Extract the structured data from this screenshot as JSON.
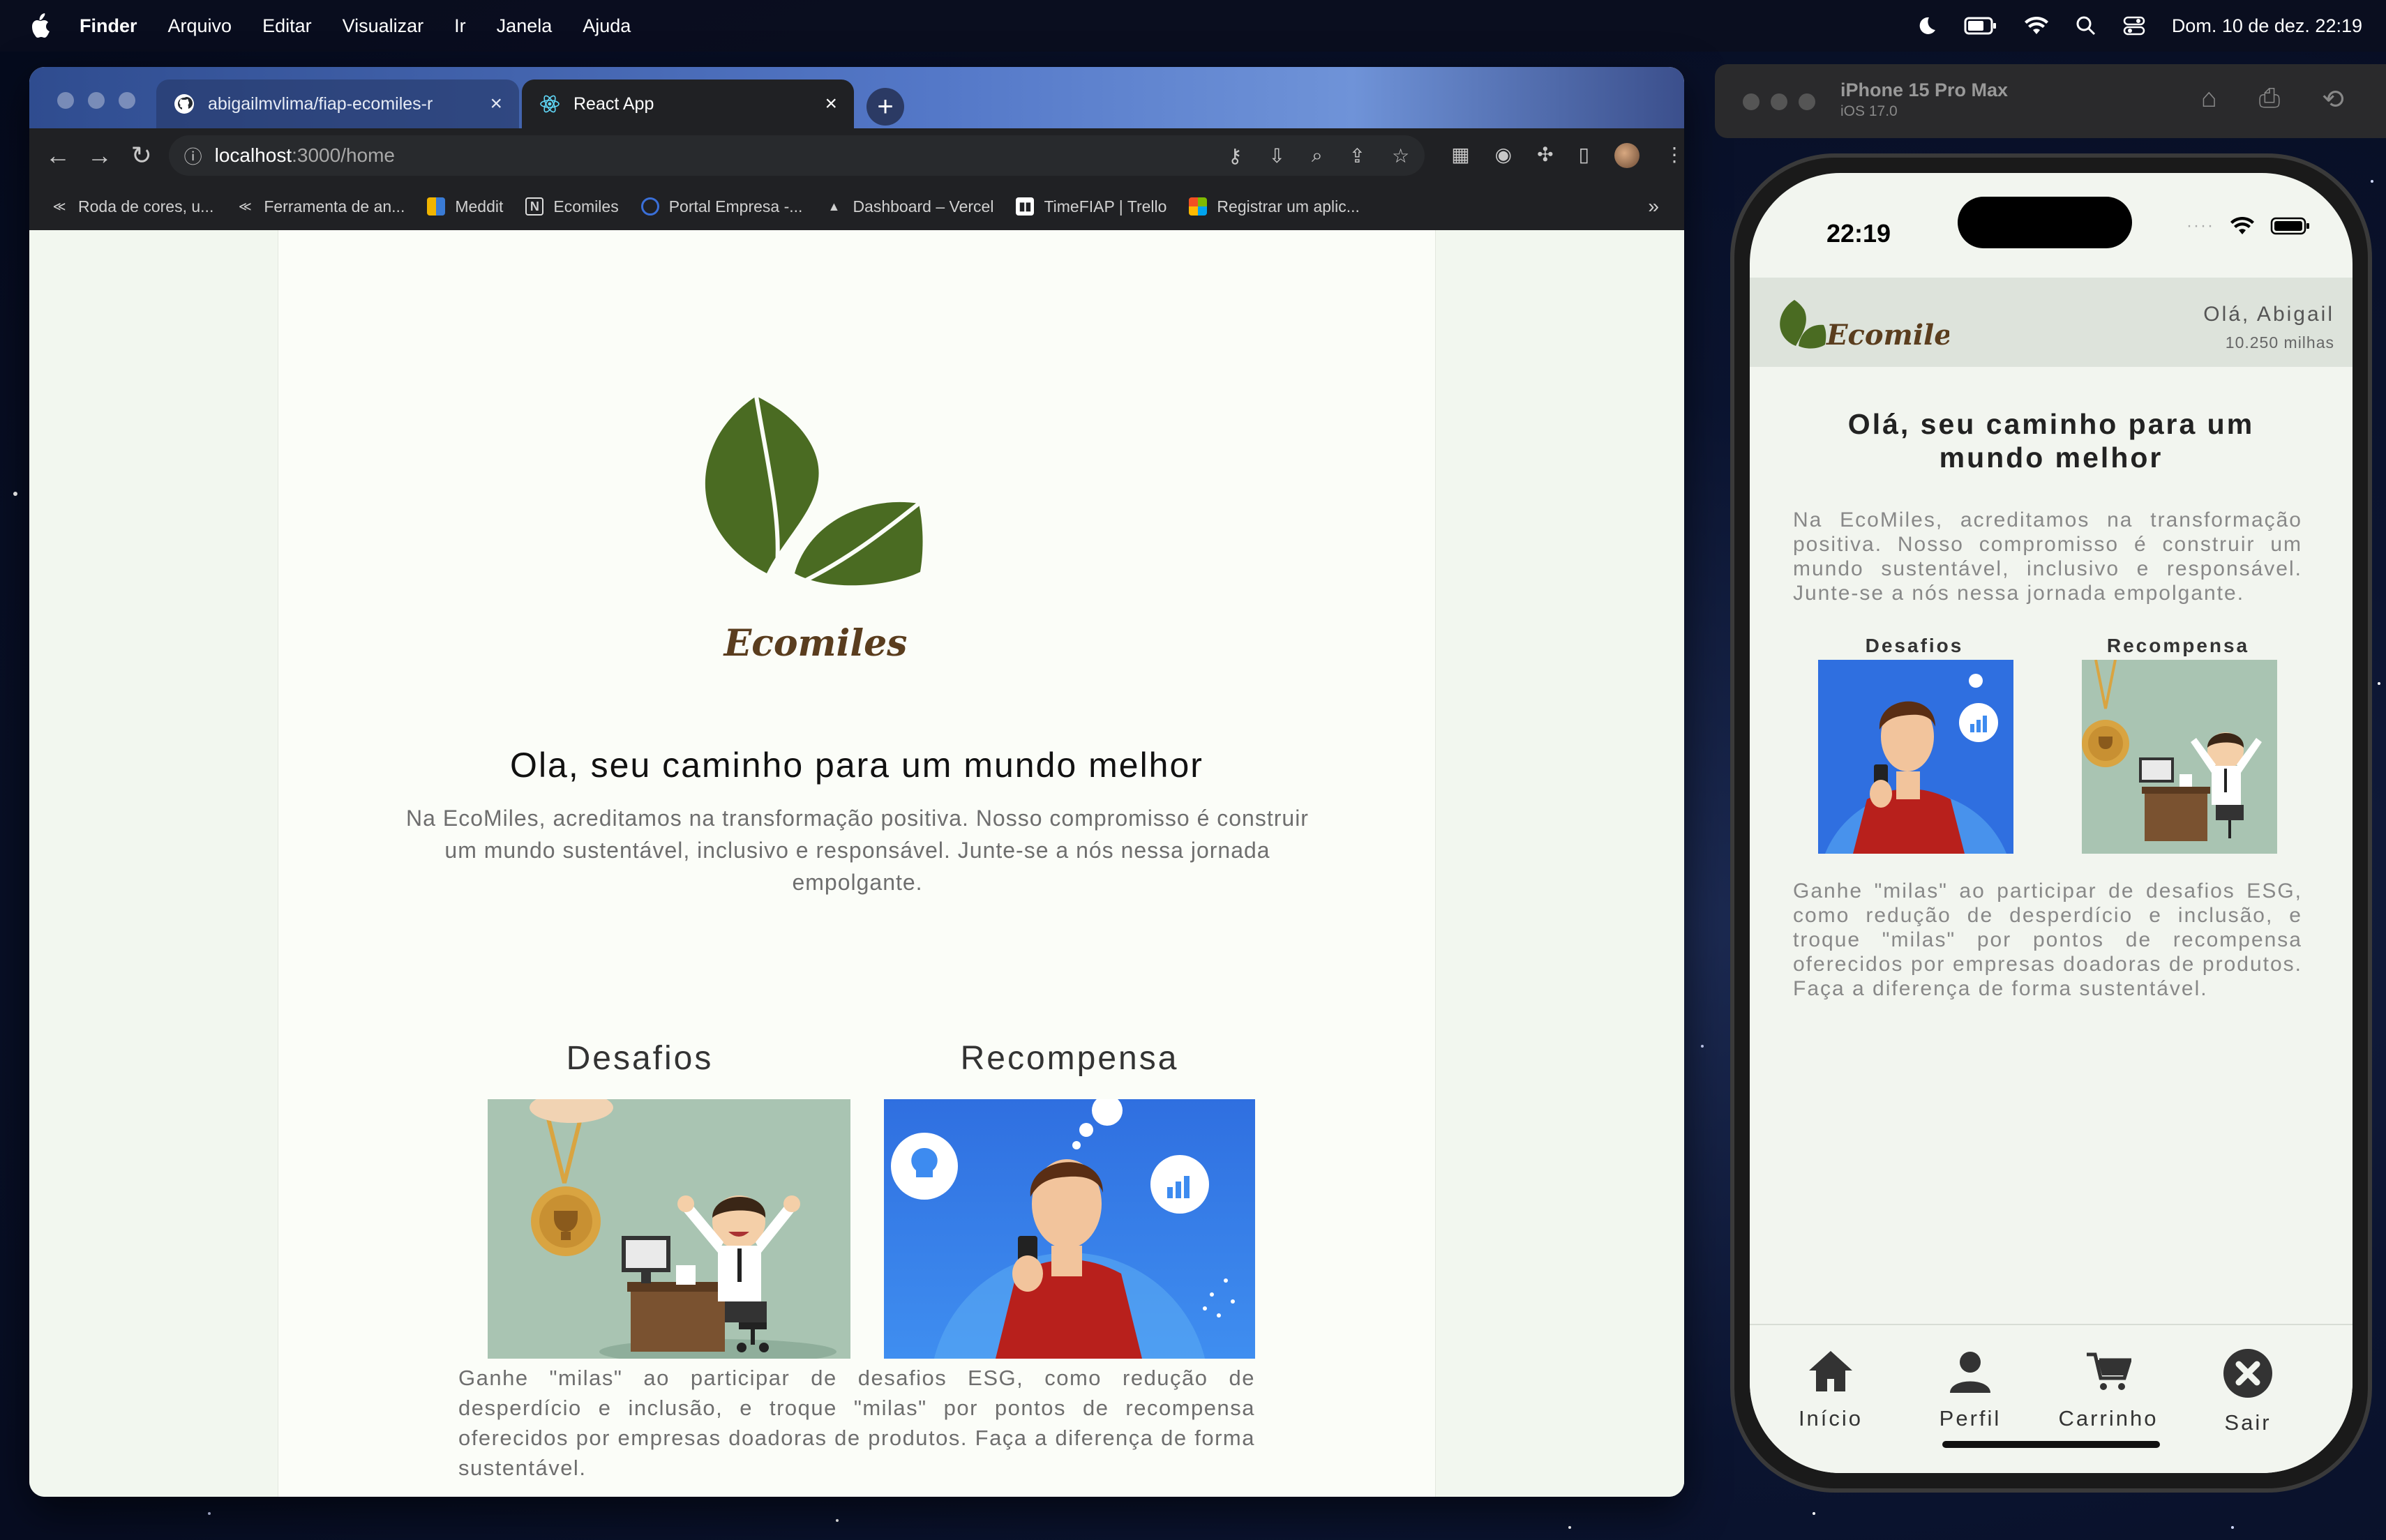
{
  "menubar": {
    "app_name": "Finder",
    "items": [
      "Arquivo",
      "Editar",
      "Visualizar",
      "Ir",
      "Janela",
      "Ajuda"
    ],
    "datetime": "Dom. 10 de dez.  22:19"
  },
  "browser": {
    "tabs": [
      {
        "title": "abigailmvlima/fiap-ecomiles-r",
        "icon": "github-icon"
      },
      {
        "title": "React App",
        "icon": "react-icon"
      }
    ],
    "url_host": "localhost",
    "url_path": ":3000/home",
    "bookmarks": [
      "Roda de cores, u...",
      "Ferramenta de an...",
      "Meddit",
      "Ecomiles",
      "Portal Empresa -...",
      "Dashboard – Vercel",
      "TimeFIAP | Trello",
      "Registrar um aplic..."
    ]
  },
  "web": {
    "logo_text": "Ecomiles",
    "title": "Ola, seu caminho para um mundo melhor",
    "intro": "Na EcoMiles, acreditamos na transformação positiva. Nosso compromisso é construir um mundo sustentável, inclusivo e responsável. Junte-se a nós nessa jornada empolgante.",
    "card1_title": "Desafios",
    "card2_title": "Recompensa",
    "description": "Ganhe \"milas\" ao participar de desafios ESG, como redução de desperdício e inclusão, e troque \"milas\" por pontos de recompensa oferecidos por empresas doadoras de produtos. Faça a diferença de forma sustentável."
  },
  "simulator": {
    "device": "iPhone 15 Pro Max",
    "os": "iOS 17.0"
  },
  "mobile": {
    "time": "22:19",
    "logo_text": "Ecomiles",
    "greeting": "Olá, Abigail",
    "miles": "10.250 milhas",
    "title": "Olá, seu caminho para um mundo melhor",
    "intro": "Na EcoMiles, acreditamos na transformação positiva. Nosso compromisso é construir um mundo sustentável, inclusivo e responsável. Junte-se a nós nessa jornada empolgante.",
    "card1_title": "Desafios",
    "card2_title": "Recompensa",
    "description": "Ganhe \"milas\" ao participar de desafios ESG, como redução de desperdício e inclusão, e troque \"milas\" por pontos de recompensa oferecidos por empresas doadoras de produtos. Faça a diferença de forma sustentável.",
    "tabs": [
      {
        "label": "Início",
        "icon": "home-icon"
      },
      {
        "label": "Perfil",
        "icon": "user-icon"
      },
      {
        "label": "Carrinho",
        "icon": "cart-icon"
      },
      {
        "label": "Sair",
        "icon": "close-circle-icon"
      }
    ]
  },
  "colors": {
    "leaf_green": "#4a6b22",
    "logo_brown": "#5a3d1e",
    "page_bg": "#fbfdf8"
  }
}
